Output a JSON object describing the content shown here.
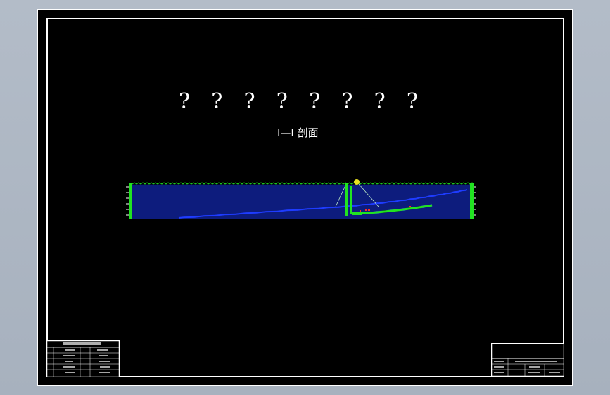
{
  "drawing": {
    "title_glyphs": [
      "?",
      "?",
      "?",
      "?",
      "?",
      "?",
      "?",
      "?"
    ],
    "section_label": "I—I 剖面"
  },
  "colors": {
    "sheet": "#000000",
    "frame": "#ffffff",
    "strata": "#1a2fd0",
    "pipe": "#21e321",
    "marker": "#ff2a2a",
    "node": "#e8e020",
    "background": "#a9b3c0"
  }
}
